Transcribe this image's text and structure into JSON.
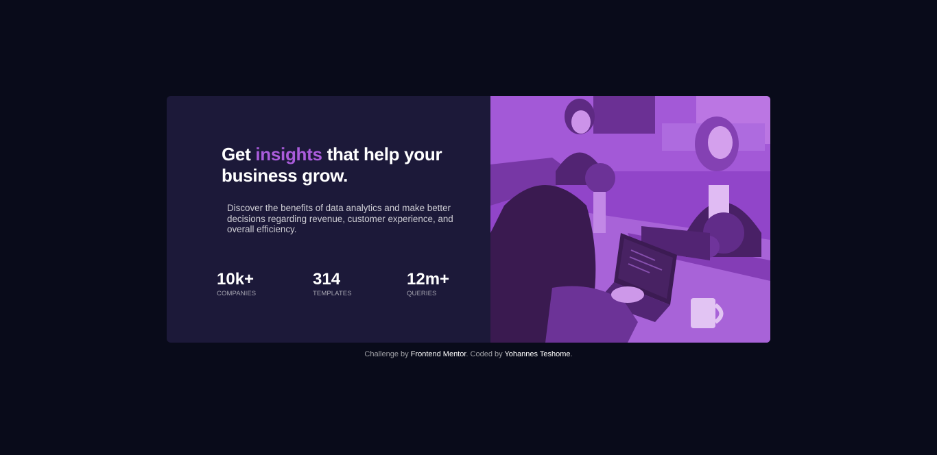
{
  "card": {
    "heading_pre": "Get ",
    "heading_accent": "insights",
    "heading_post": " that help your business grow.",
    "description": "Discover the benefits of data analytics and make better decisions regarding revenue, customer experience, and overall efficiency.",
    "stats": [
      {
        "value": "10k+",
        "label": "Companies"
      },
      {
        "value": "314",
        "label": "Templates"
      },
      {
        "value": "12m+",
        "label": "Queries"
      }
    ],
    "image_icon": "office-photo"
  },
  "footer": {
    "prefix": "Challenge by ",
    "link1": "Frontend Mentor",
    "middle": ". Coded by ",
    "link2": "Yohannes Teshome",
    "suffix": "."
  },
  "colors": {
    "background": "#090b1a",
    "card": "#1c1939",
    "accent": "#aa5cdb",
    "image_tint": "#8a3cc2"
  }
}
